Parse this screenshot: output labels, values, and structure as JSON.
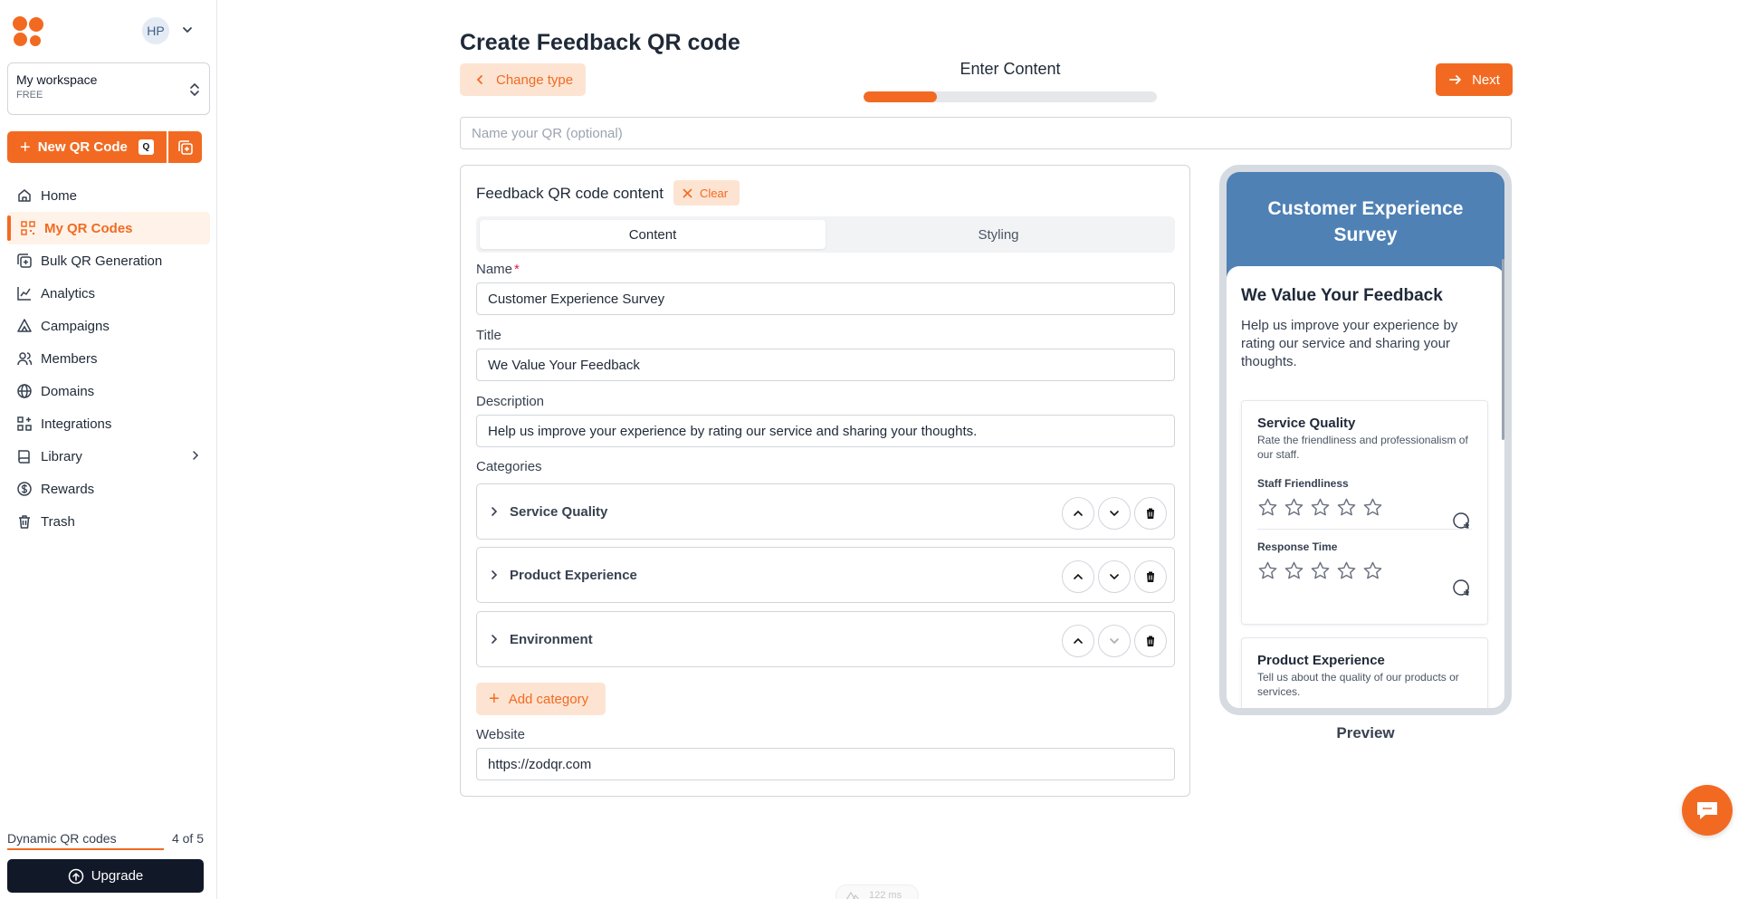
{
  "sidebar": {
    "avatar_initials": "HP",
    "workspace": {
      "name": "My workspace",
      "plan": "FREE"
    },
    "new_qr": {
      "label": "New QR Code",
      "shortcut": "Q"
    },
    "nav": [
      {
        "label": "Home",
        "icon": "home-icon"
      },
      {
        "label": "My QR Codes",
        "icon": "qr-grid-icon",
        "active": true
      },
      {
        "label": "Bulk QR Generation",
        "icon": "bulk-icon"
      },
      {
        "label": "Analytics",
        "icon": "analytics-icon"
      },
      {
        "label": "Campaigns",
        "icon": "campaign-icon"
      },
      {
        "label": "Members",
        "icon": "members-icon"
      },
      {
        "label": "Domains",
        "icon": "globe-icon"
      },
      {
        "label": "Integrations",
        "icon": "integrations-icon"
      },
      {
        "label": "Library",
        "icon": "library-icon"
      },
      {
        "label": "Rewards",
        "icon": "rewards-icon"
      },
      {
        "label": "Trash",
        "icon": "trash-icon"
      }
    ],
    "usage": {
      "label": "Dynamic QR codes",
      "count": "4 of 5"
    },
    "upgrade_label": "Upgrade"
  },
  "header": {
    "title": "Create Feedback QR code",
    "change_type_label": "Change type",
    "step_label": "Enter Content",
    "progress": 0.25,
    "next_label": "Next",
    "name_placeholder": "Name your QR (optional)"
  },
  "form": {
    "title": "Feedback QR code content",
    "clear_label": "Clear",
    "tabs": [
      "Content",
      "Styling"
    ],
    "name_label": "Name",
    "name_value": "Customer Experience Survey",
    "title_label": "Title",
    "title_value": "We Value Your Feedback",
    "description_label": "Description",
    "description_value": "Help us improve your experience by rating our service and sharing your thoughts.",
    "categories_label": "Categories",
    "categories": [
      "Service Quality",
      "Product Experience",
      "Environment"
    ],
    "add_category_label": "Add category",
    "website_label": "Website",
    "website_value": "https://zodqr.com"
  },
  "preview": {
    "header": "Customer Experience Survey",
    "title": "We Value Your Feedback",
    "description": "Help us improve your experience by rating our service and sharing your thoughts.",
    "section1": {
      "title": "Service Quality",
      "description": "Rate the friendliness and professionalism of our staff.",
      "q1": "Staff Friendliness",
      "q2": "Response Time"
    },
    "section2": {
      "title": "Product Experience",
      "description": "Tell us about the quality of our products or services."
    },
    "label": "Preview"
  },
  "devtools": {
    "timing": "122 ms"
  },
  "colors": {
    "accent": "#f26a21",
    "preview_header": "#4f81b5",
    "dark": "#111827"
  }
}
